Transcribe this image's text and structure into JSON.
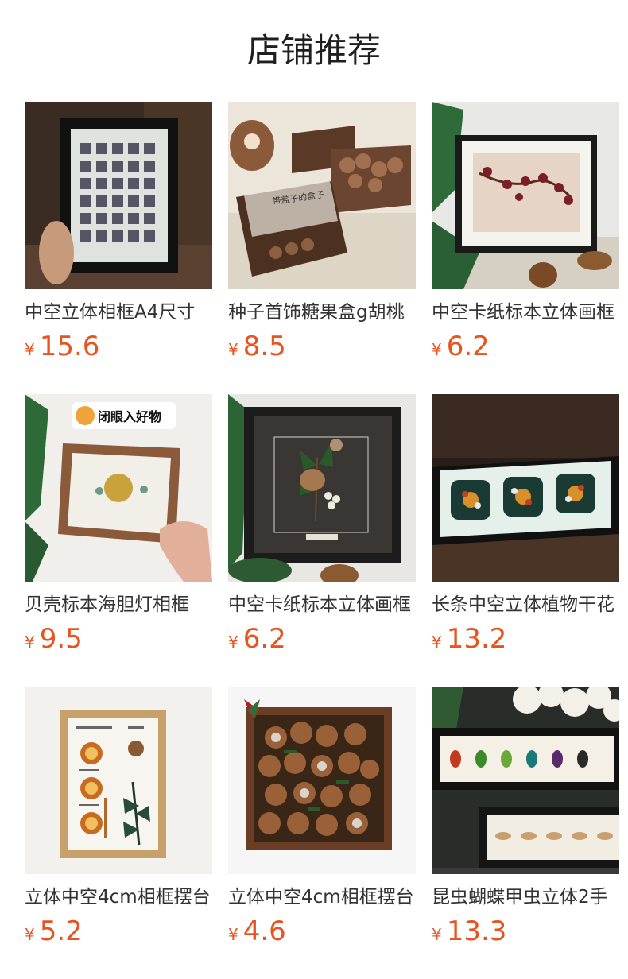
{
  "section": {
    "title": "店铺推荐"
  },
  "products": [
    {
      "name": "中空立体相框A4尺寸",
      "currency": "¥",
      "price": "15.6",
      "image": "framed-mineral-grid-photo"
    },
    {
      "name": "种子首饰糖果盒g胡桃",
      "currency": "¥",
      "price": "8.5",
      "image": "wooden-seed-boxes-photo",
      "image_caption": "带盖子的盒子"
    },
    {
      "name": "中空卡纸标本立体画框",
      "currency": "¥",
      "price": "6.2",
      "image": "dried-flower-branch-frame-photo"
    },
    {
      "name": "贝壳标本海胆灯相框",
      "currency": "¥",
      "price": "9.5",
      "image": "sea-urchin-frame-photo",
      "badge": "闭眼入好物"
    },
    {
      "name": "中空卡纸标本立体画框",
      "currency": "¥",
      "price": "6.2",
      "image": "pinecone-botanical-frame-photo"
    },
    {
      "name": "长条中空立体植物干花",
      "currency": "¥",
      "price": "13.2",
      "image": "long-succulent-frame-photo"
    },
    {
      "name": "立体中空4cm相框摆台",
      "currency": "¥",
      "price": "5.2",
      "image": "citrus-slice-specimen-frame-photo"
    },
    {
      "name": "立体中空4cm相框摆台",
      "currency": "¥",
      "price": "4.6",
      "image": "pinecone-collage-frame-photo"
    },
    {
      "name": "昆虫蝴蝶甲虫立体2手",
      "currency": "¥",
      "price": "13.3",
      "image": "insect-specimen-frames-photo"
    }
  ]
}
